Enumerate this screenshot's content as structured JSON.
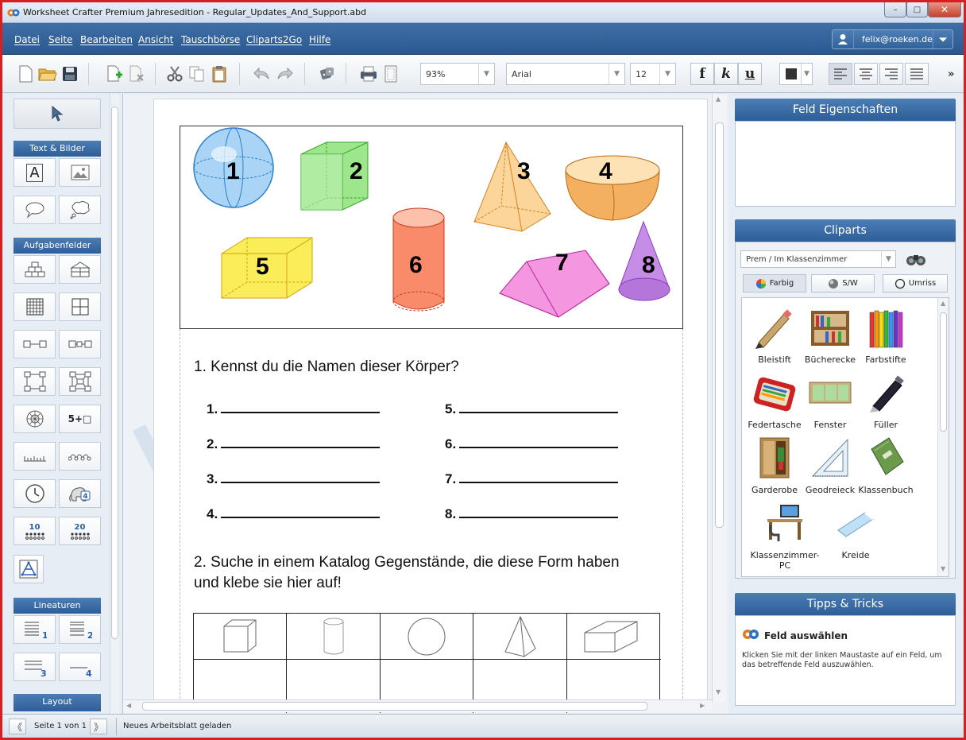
{
  "window": {
    "title": "Worksheet Crafter Premium Jahresedition - Regular_Updates_And_Support.abd",
    "minimize": "–",
    "maximize": "□",
    "close": "✕"
  },
  "menu": {
    "items": [
      "Datei",
      "Seite",
      "Bearbeiten",
      "Ansicht",
      "Tauschbörse",
      "Cliparts2Go",
      "Hilfe"
    ],
    "user": "felix@roeken.de"
  },
  "toolbar": {
    "zoom": "93%",
    "font": "Arial",
    "size": "12",
    "bold": "f",
    "italic": "k",
    "underline": "u",
    "more": "»"
  },
  "left": {
    "sections": {
      "text_images": "Text & Bilder",
      "tasks": "Aufgabenfelder",
      "lines": "Lineaturen",
      "layout": "Layout"
    },
    "labels": {
      "ten": "10",
      "twenty": "20",
      "five_plus": "5+□",
      "text_tool": "A",
      "line1": "1",
      "line2": "2",
      "line3": "3",
      "line4": "4"
    }
  },
  "worksheet": {
    "shape_numbers": [
      "1",
      "2",
      "3",
      "4",
      "5",
      "6",
      "7",
      "8"
    ],
    "question1": "1. Kennst du die Namen dieser Körper?",
    "answers_left": [
      "1.",
      "2.",
      "3.",
      "4."
    ],
    "answers_right": [
      "5.",
      "6.",
      "7.",
      "8."
    ],
    "question2_line1": "2. Suche in einem Katalog Gegenstände, die diese Form haben",
    "question2_line2": "und klebe sie hier auf!"
  },
  "right": {
    "props_title": "Feld Eigenschaften",
    "cliparts_title": "Cliparts",
    "category": "Prem / Im Klassenzimmer",
    "tabs": [
      "Farbig",
      "S/W",
      "Umriss"
    ],
    "cliparts": [
      "Bleistift",
      "Bücherecke",
      "Farbstifte",
      "Federtasche",
      "Fenster",
      "Füller",
      "Garderobe",
      "Geodreieck",
      "Klassenbuch",
      "Klassenzimmer-PC",
      "Kreide"
    ],
    "tips_title": "Tipps & Tricks",
    "tip_heading": "Feld auswählen",
    "tip_text": "Klicken Sie mit der linken Maustaste auf ein Feld, um das betreffende Feld auszuwählen."
  },
  "status": {
    "page": "Seite 1 von 1",
    "message": "Neues Arbeitsblatt geladen"
  }
}
